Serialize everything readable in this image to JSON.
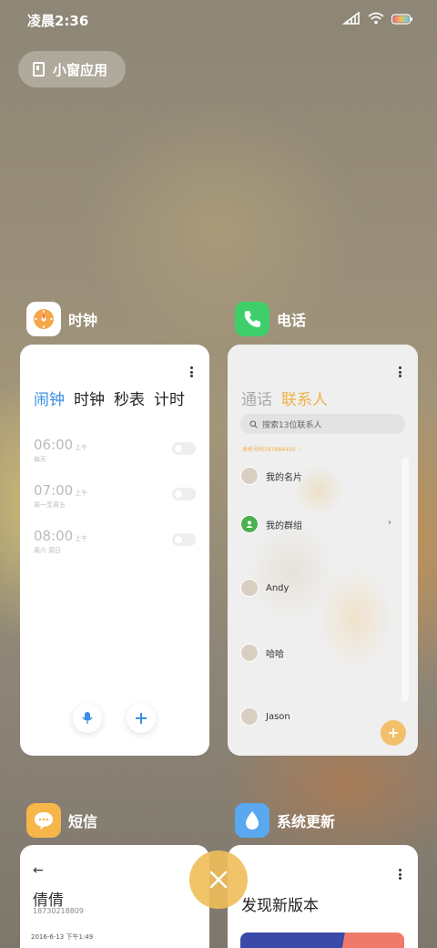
{
  "status": {
    "time": "凌晨2:36"
  },
  "floating_window_button": {
    "label": "小窗应用"
  },
  "apps": {
    "clock": {
      "name": "时钟",
      "tabs": [
        "闹钟",
        "时钟",
        "秒表",
        "计时"
      ],
      "alarms": [
        {
          "time": "06:00",
          "ampm": "上午",
          "days": "每天"
        },
        {
          "time": "07:00",
          "ampm": "上午",
          "days": "周一至周五"
        },
        {
          "time": "08:00",
          "ampm": "上午",
          "days": "周六 周日"
        }
      ]
    },
    "phone": {
      "name": "电话",
      "tabs": [
        "通话",
        "联系人"
      ],
      "search_placeholder": "搜索13位联系人",
      "my_number": "本机号码187884400 ♡",
      "contacts": [
        "我的名片",
        "我的群组",
        "Andy",
        "哈哈",
        "Jason"
      ]
    },
    "sms": {
      "name": "短信",
      "contact_name": "倩倩",
      "contact_number": "18730218809",
      "date": "2016-6-13 下午1:49"
    },
    "update": {
      "name": "系统更新",
      "title": "发现新版本"
    }
  }
}
